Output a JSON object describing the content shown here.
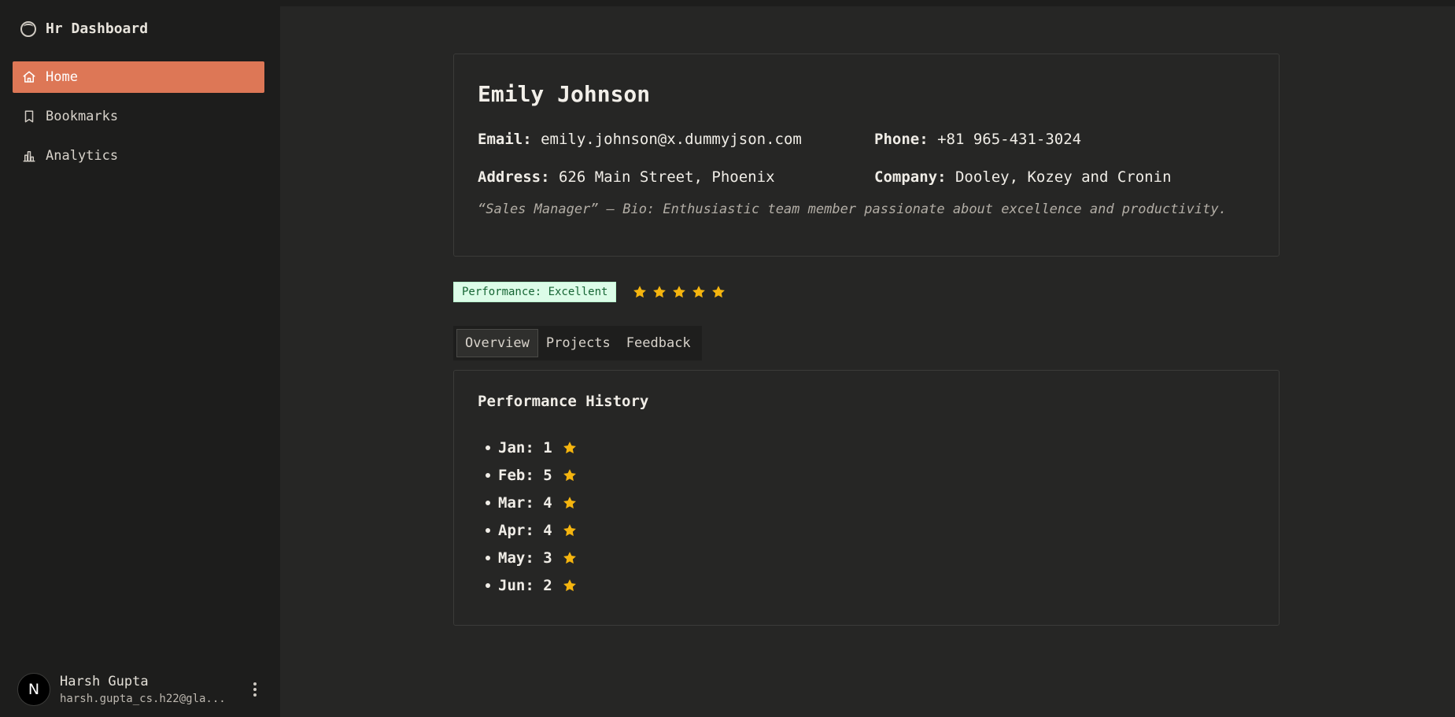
{
  "app": {
    "title": "Hr Dashboard"
  },
  "nav": [
    {
      "label": "Home",
      "icon": "home-icon",
      "active": true
    },
    {
      "label": "Bookmarks",
      "icon": "bookmark-icon",
      "active": false
    },
    {
      "label": "Analytics",
      "icon": "bar-chart-icon",
      "active": false
    }
  ],
  "user": {
    "initial": "N",
    "name": "Harsh Gupta",
    "email": "harsh.gupta_cs.h22@gla..."
  },
  "employee": {
    "name": "Emily Johnson",
    "email_label": "Email:",
    "email": "emily.johnson@x.dummyjson.com",
    "phone_label": "Phone:",
    "phone": "+81 965-431-3024",
    "address_label": "Address:",
    "address": "626 Main Street, Phoenix",
    "company_label": "Company:",
    "company": "Dooley, Kozey and Cronin",
    "bio": "“Sales Manager” — Bio: Enthusiastic team member passionate about excellence and productivity."
  },
  "performance": {
    "badge": "Performance: Excellent",
    "rating": 5,
    "star_color": "#f5b50f"
  },
  "tabs": [
    {
      "label": "Overview",
      "active": true
    },
    {
      "label": "Projects",
      "active": false
    },
    {
      "label": "Feedback",
      "active": false
    }
  ],
  "history": {
    "title": "Performance History",
    "items": [
      {
        "label": "Jan: 1"
      },
      {
        "label": "Feb: 5"
      },
      {
        "label": "Mar: 4"
      },
      {
        "label": "Apr: 4"
      },
      {
        "label": "May: 3"
      },
      {
        "label": "Jun: 2"
      }
    ]
  },
  "colors": {
    "accent": "#dd7756",
    "badge_bg": "#dcfce8",
    "badge_text": "#166534"
  }
}
